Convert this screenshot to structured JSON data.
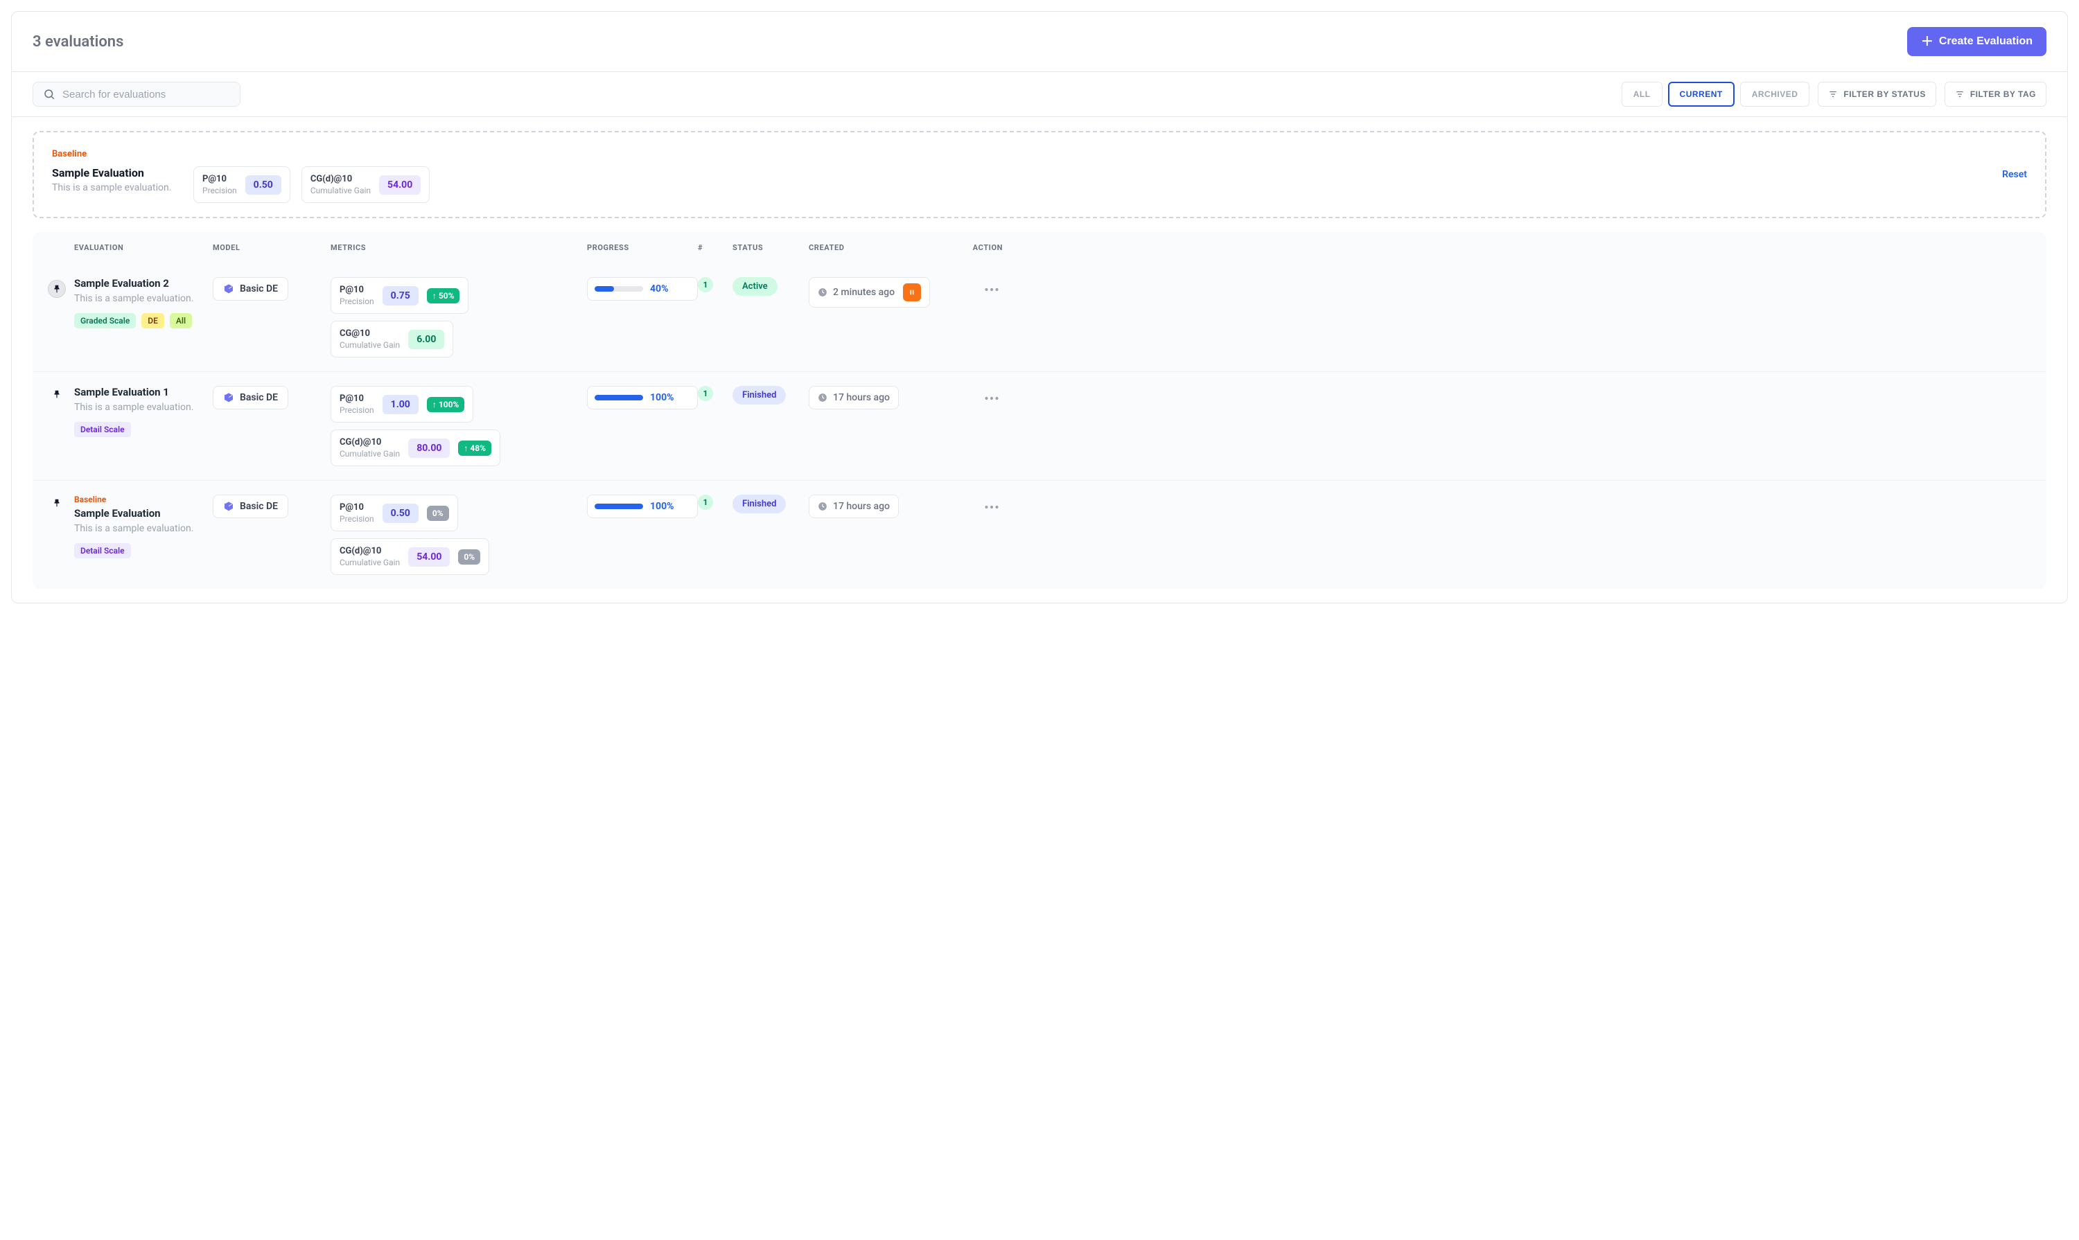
{
  "header": {
    "count_label": "3 evaluations",
    "create_button": "Create Evaluation"
  },
  "search": {
    "placeholder": "Search for evaluations"
  },
  "tabs": {
    "all": "ALL",
    "current": "CURRENT",
    "archived": "ARCHIVED"
  },
  "filters": {
    "status": "FILTER BY STATUS",
    "tag": "FILTER BY TAG"
  },
  "baseline": {
    "label": "Baseline",
    "title": "Sample Evaluation",
    "subtitle": "This is a sample evaluation.",
    "reset": "Reset",
    "metrics": [
      {
        "title": "P@10",
        "sub": "Precision",
        "value": "0.50",
        "color": "blue"
      },
      {
        "title": "CG(d)@10",
        "sub": "Cumulative Gain",
        "value": "54.00",
        "color": "purple"
      }
    ]
  },
  "columns": {
    "evaluation": "EVALUATION",
    "model": "MODEL",
    "metrics": "METRICS",
    "progress": "PROGRESS",
    "num": "#",
    "status": "STATUS",
    "created": "CREATED",
    "action": "ACTION"
  },
  "rows": [
    {
      "pinned": true,
      "baseline": false,
      "name": "Sample Evaluation 2",
      "desc": "This is a sample evaluation.",
      "tags": [
        {
          "text": "Graded Scale",
          "cls": "green"
        },
        {
          "text": "DE",
          "cls": "yellow"
        },
        {
          "text": "All",
          "cls": "lime"
        }
      ],
      "model": "Basic DE",
      "metrics": [
        {
          "title": "P@10",
          "sub": "Precision",
          "value": "0.75",
          "color": "blue",
          "delta": "50%",
          "delta_type": "up"
        },
        {
          "title": "CG@10",
          "sub": "Cumulative Gain",
          "value": "6.00",
          "color": "green"
        }
      ],
      "progress_pct": 40,
      "progress_label": "40%",
      "num": "1",
      "status": "Active",
      "status_cls": "active",
      "created": "2 minutes ago",
      "has_pause": true
    },
    {
      "pinned": false,
      "baseline": false,
      "name": "Sample Evaluation 1",
      "desc": "This is a sample evaluation.",
      "tags": [
        {
          "text": "Detail Scale",
          "cls": "purple"
        }
      ],
      "model": "Basic DE",
      "metrics": [
        {
          "title": "P@10",
          "sub": "Precision",
          "value": "1.00",
          "color": "blue",
          "delta": "100%",
          "delta_type": "up"
        },
        {
          "title": "CG(d)@10",
          "sub": "Cumulative Gain",
          "value": "80.00",
          "color": "purple",
          "delta": "48%",
          "delta_type": "up"
        }
      ],
      "progress_pct": 100,
      "progress_label": "100%",
      "num": "1",
      "status": "Finished",
      "status_cls": "finished",
      "created": "17 hours ago",
      "has_pause": false
    },
    {
      "pinned": false,
      "baseline": true,
      "baseline_label": "Baseline",
      "name": "Sample Evaluation",
      "desc": "This is a sample evaluation.",
      "tags": [
        {
          "text": "Detail Scale",
          "cls": "purple"
        }
      ],
      "model": "Basic DE",
      "metrics": [
        {
          "title": "P@10",
          "sub": "Precision",
          "value": "0.50",
          "color": "blue",
          "delta": "0%",
          "delta_type": "neutral"
        },
        {
          "title": "CG(d)@10",
          "sub": "Cumulative Gain",
          "value": "54.00",
          "color": "purple",
          "delta": "0%",
          "delta_type": "neutral"
        }
      ],
      "progress_pct": 100,
      "progress_label": "100%",
      "num": "1",
      "status": "Finished",
      "status_cls": "finished",
      "created": "17 hours ago",
      "has_pause": false
    }
  ]
}
